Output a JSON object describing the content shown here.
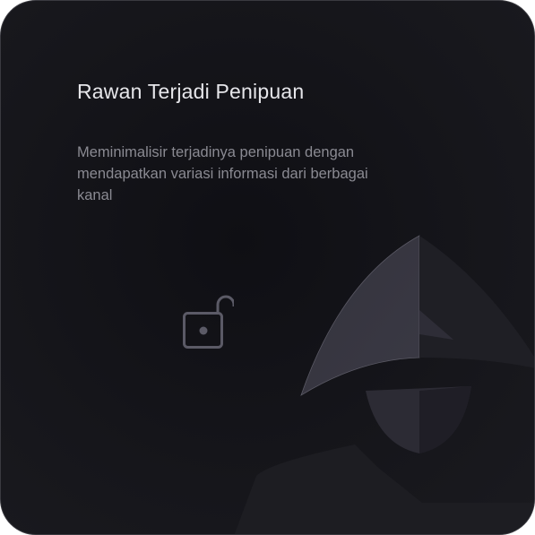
{
  "card": {
    "title": "Rawan Terjadi Penipuan",
    "description": "Meminimalisir terjadinya penipuan dengan mendapatkan variasi informasi dari berbagai kanal"
  },
  "icons": {
    "lock": "unlocked-padlock-icon",
    "figure": "hooded-figure-illustration"
  }
}
